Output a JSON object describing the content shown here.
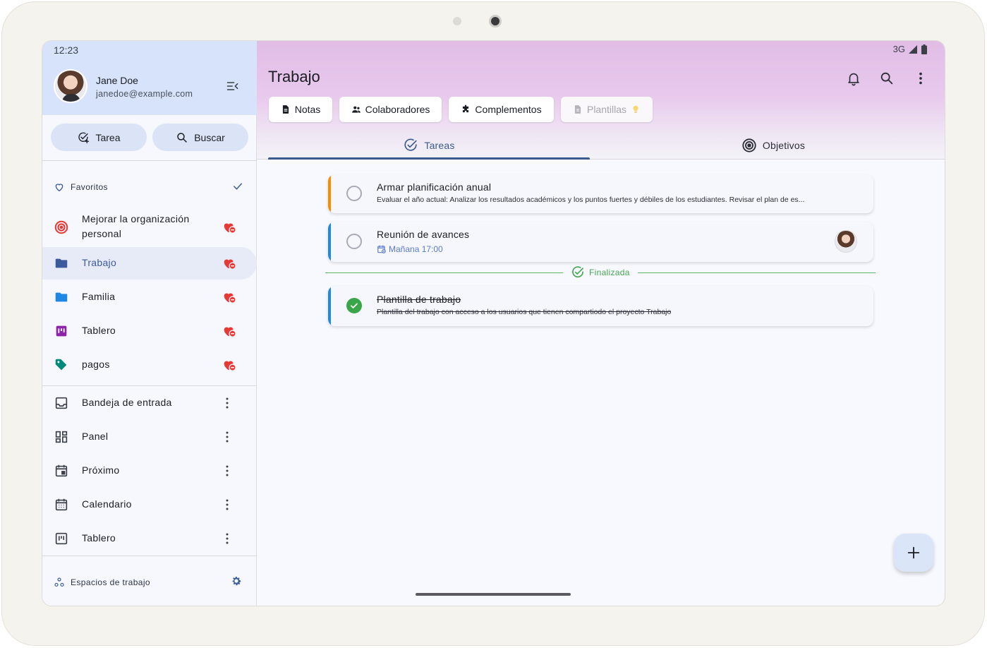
{
  "status": {
    "time": "12:23",
    "network": "3G"
  },
  "user": {
    "name": "Jane Doe",
    "email": "janedoe@example.com"
  },
  "sidebar": {
    "task_button": "Tarea",
    "search_button": "Buscar",
    "favorites_label": "Favoritos",
    "favorites": [
      {
        "label": "Mejorar la organización personal",
        "icon": "target-icon",
        "color": "#e53935"
      },
      {
        "label": "Trabajo",
        "icon": "folder-icon",
        "color": "#3b5b9c",
        "active": true
      },
      {
        "label": "Familia",
        "icon": "folder-icon",
        "color": "#1e88e5"
      },
      {
        "label": "Tablero",
        "icon": "board-icon",
        "color": "#8e24aa"
      },
      {
        "label": "pagos",
        "icon": "tag-icon",
        "color": "#00897b"
      }
    ],
    "nav": [
      {
        "label": "Bandeja de entrada",
        "icon": "inbox-icon"
      },
      {
        "label": "Panel",
        "icon": "dashboard-icon"
      },
      {
        "label": "Próximo",
        "icon": "calendar-next-icon"
      },
      {
        "label": "Calendario",
        "icon": "calendar-icon"
      },
      {
        "label": "Tablero",
        "icon": "board-outline-icon"
      }
    ],
    "workspaces_label": "Espacios de trabajo"
  },
  "main": {
    "title": "Trabajo",
    "chips": [
      "Notas",
      "Colaboradores",
      "Complementos",
      "Plantillas"
    ],
    "tabs": [
      "Tareas",
      "Objetivos"
    ],
    "tasks": [
      {
        "title": "Armar planificación anual",
        "description": "Evaluar el año actual: Analizar los resultados académicos y los puntos fuertes y débiles de los estudiantes. Revisar el plan de es...",
        "color": "#fb8c00",
        "done": false
      },
      {
        "title": "Reunión de avances",
        "due": "Mañana 17:00",
        "color": "#1e88e5",
        "done": false
      },
      {
        "title": "Plantilla de trabajo",
        "description": "Plantilla del trabajo con acceso a los usuarios que tienen compartiodo el proyecto Trabajo",
        "color": "#1e88e5",
        "done": true
      }
    ],
    "done_divider": "Finalizada"
  }
}
